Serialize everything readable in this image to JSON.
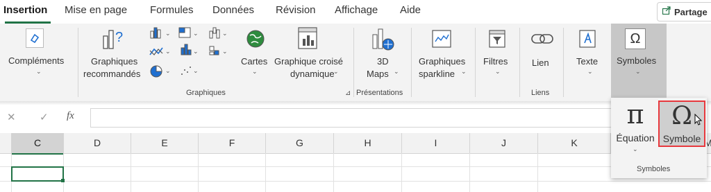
{
  "tabs": [
    {
      "label": "Insertion"
    },
    {
      "label": "Mise en page"
    },
    {
      "label": "Formules"
    },
    {
      "label": "Données"
    },
    {
      "label": "Révision"
    },
    {
      "label": "Affichage"
    },
    {
      "label": "Aide"
    }
  ],
  "share_label": "Partage",
  "ribbon": {
    "complements": {
      "line1": "Compléments",
      "icon": "addins-icon"
    },
    "graphiques_reco": {
      "line1": "Graphiques",
      "line2": "recommandés",
      "icon": "chart-question-icon"
    },
    "cartes": {
      "line1": "Cartes",
      "icon": "globe-icon"
    },
    "pivot_chart": {
      "line1": "Graphique croisé",
      "line2": "dynamique",
      "icon": "pivot-chart-icon"
    },
    "maps3d": {
      "line1": "3D",
      "line2": "Maps",
      "icon": "3d-maps-icon"
    },
    "sparkline": {
      "line1": "Graphiques",
      "line2": "sparkline",
      "icon": "sparkline-icon"
    },
    "filtres": {
      "line1": "Filtres",
      "icon": "filter-icon"
    },
    "lien": {
      "line1": "Lien",
      "icon": "link-icon"
    },
    "texte": {
      "line1": "Texte",
      "icon": "text-icon"
    },
    "symboles": {
      "line1": "Symboles",
      "glyph": "Ω"
    },
    "groups": {
      "graphiques": "Graphiques",
      "presentations": "Présentations",
      "liens": "Liens"
    }
  },
  "formula_bar": {
    "cancel": "✕",
    "enter": "✓",
    "fx": "fx",
    "value": ""
  },
  "columns": [
    "C",
    "D",
    "E",
    "F",
    "G",
    "H",
    "I",
    "J",
    "K",
    "M"
  ],
  "popup": {
    "equation_glyph": "π",
    "equation_label": "Équation",
    "symbol_glyph": "Ω",
    "symbol_label": "Symbole",
    "group_label": "Symboles"
  },
  "colors": {
    "accent": "#217346",
    "highlight": "#e8383d"
  }
}
